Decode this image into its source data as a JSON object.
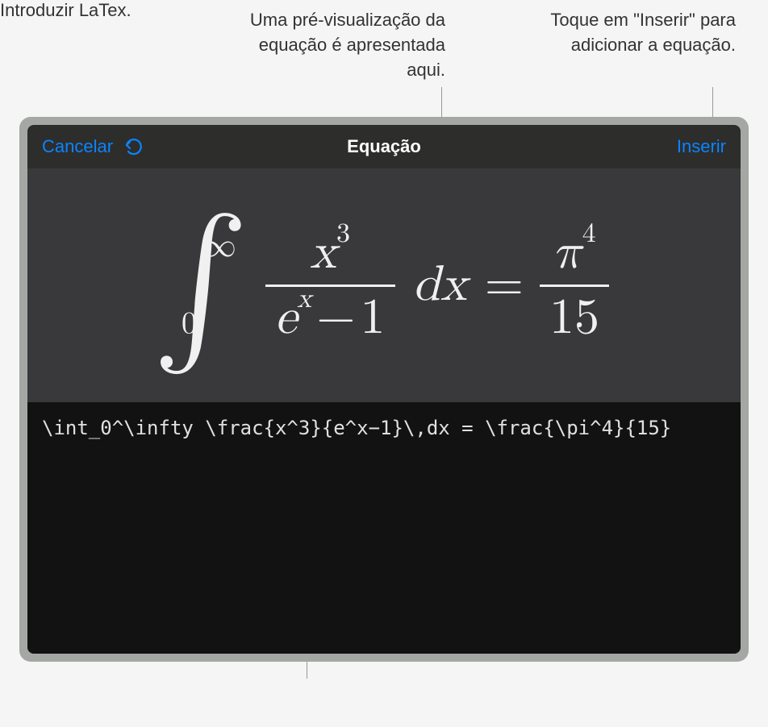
{
  "callouts": {
    "preview": "Uma pré-visualização da equação é apresentada aqui.",
    "insert": "Toque em \"Inserir\" para adicionar a equação.",
    "latex": "Introduzir LaTex."
  },
  "navbar": {
    "cancel": "Cancelar",
    "title": "Equação",
    "insert": "Inserir"
  },
  "equation": {
    "integral_upper": "∞",
    "integral_lower": "0",
    "frac1_top_var": "x",
    "frac1_top_exp": "3",
    "frac1_bot_base": "e",
    "frac1_bot_exp": "x",
    "frac1_bot_op": "−",
    "frac1_bot_const": "1",
    "dx_d": "d",
    "dx_x": "x",
    "equals": "=",
    "frac2_top_var": "π",
    "frac2_top_exp": "4",
    "frac2_bot": "15"
  },
  "latex_source": "\\int_0^\\infty \\frac{x^3}{e^x−1}\\,dx = \\frac{\\pi^4}{15}"
}
